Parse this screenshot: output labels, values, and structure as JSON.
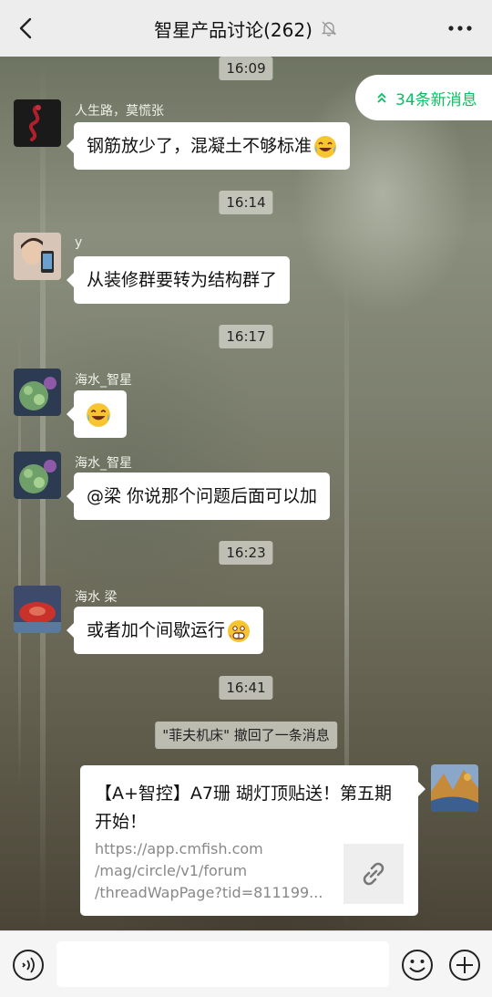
{
  "header": {
    "title": "智星产品讨论(262)",
    "back_icon": "back-chevron-icon",
    "mute_icon": "bell-off-icon",
    "more_icon": "more-dots-icon"
  },
  "new_messages": {
    "label": "34条新消息",
    "icon": "double-chevron-up-icon",
    "color": "#07c160"
  },
  "messages": [
    {
      "time": "16:09"
    },
    {
      "sender": "人生路，莫慌张",
      "text": "钢筋放少了，混凝土不够标准",
      "emoji": "laughing-crying-emoji"
    },
    {
      "time": "16:14"
    },
    {
      "sender": "y",
      "text": "从装修群要转为结构群了"
    },
    {
      "time": "16:17"
    },
    {
      "sender": "海水_智星",
      "emoji": "laughing-crying-emoji"
    },
    {
      "sender": "海水_智星",
      "text": "@梁  你说那个问题后面可以加"
    },
    {
      "time": "16:23"
    },
    {
      "sender": "海水 梁",
      "text": "或者加个间歇运行",
      "emoji": "grimace-emoji"
    },
    {
      "time": "16:41"
    },
    {
      "system": "\"菲夫机床\" 撤回了一条消息"
    }
  ],
  "link_card": {
    "title": "【A+智控】A7珊 瑚灯顶贴送！第五期开始！",
    "url_lines": [
      "https://app.cmfish.com",
      "/mag/circle/v1/forum",
      "/threadWapPage?tid=811199..."
    ],
    "thumb_icon": "link-icon"
  },
  "input_bar": {
    "voice_icon": "voice-icon",
    "emoji_icon": "smiley-icon",
    "plus_icon": "plus-circle-icon",
    "input_value": ""
  }
}
